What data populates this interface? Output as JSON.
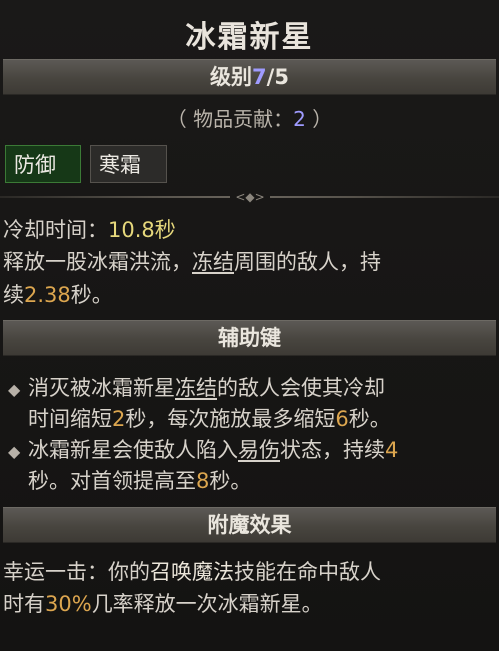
{
  "title": "冰霜新星",
  "rank": {
    "label": "级别",
    "current": "7",
    "sep_max": "/5"
  },
  "contribution": {
    "open": "（ 物品贡献：",
    "value": "2",
    "close": " ）"
  },
  "tags": [
    "防御",
    "寒霜"
  ],
  "description": {
    "cooldown_label": "冷却时间：",
    "cooldown_value": "10.8秒",
    "line1_a": "释放一股冰霜洪流，",
    "line1_link": "冻结",
    "line1_b": "周围的敌人，持",
    "line2_a": "续",
    "line2_value": "2.38",
    "line2_b": "秒。"
  },
  "modifiers_header": "辅助键",
  "modifier1": {
    "a": "消灭被冰霜新星",
    "link": "冻结",
    "b": "的敌人会使其冷却",
    "c": "时间缩短",
    "v1": "2",
    "d": "秒，每次施放最多缩短",
    "v2": "6",
    "e": "秒。"
  },
  "modifier2": {
    "a": "冰霜新星会使敌人陷入",
    "link": "易伤",
    "b": "状态，持续",
    "v1": "4",
    "c": "秒。对首领提高至",
    "v2": "8",
    "d": "秒。"
  },
  "enchant_header": "附魔效果",
  "enchant": {
    "a": "幸运一击：你的",
    "skill": "召唤魔法",
    "b": "技能在命中敌人",
    "c": "时有",
    "pct": "30%",
    "d": "几率释放一次冰霜新星。"
  },
  "colors": {
    "rank": "#9f9bff",
    "value_yellow": "#e6d87c",
    "value_orange": "#dca64f",
    "tag_green": "#163817"
  }
}
